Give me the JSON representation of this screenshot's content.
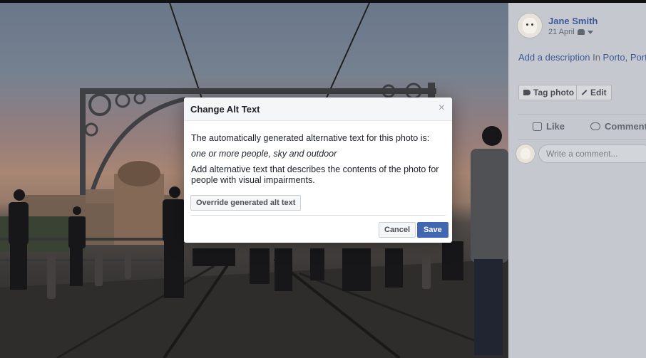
{
  "dialog": {
    "title": "Change Alt Text",
    "close_glyph": "×",
    "intro": "The automatically generated alternative text for this photo is:",
    "generated_alt": "one or more people, sky and outdoor",
    "instructions": "Add alternative text that describes the contents of the photo for people with visual impairments.",
    "override_label": "Override generated alt text",
    "cancel_label": "Cancel",
    "save_label": "Save"
  },
  "post": {
    "author": "Jane Smith",
    "date": "21 April",
    "description_link": "Add a description",
    "location_prefix": "In",
    "location": "Porto, Portugal",
    "tag_photo_label": "Tag photo",
    "edit_label": "Edit",
    "like_label": "Like",
    "comment_label": "Comment",
    "comment_placeholder": "Write a comment..."
  },
  "colors": {
    "accent": "#4267b2",
    "link": "#3b5998"
  }
}
